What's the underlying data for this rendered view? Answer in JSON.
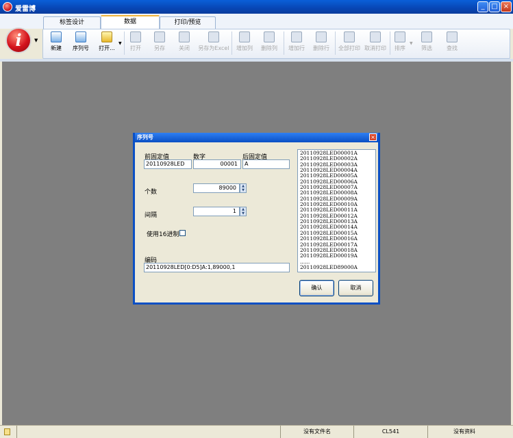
{
  "window": {
    "title": "爱雷博"
  },
  "ribbon": {
    "tabs": [
      {
        "label": "标签设计"
      },
      {
        "label": "数据"
      },
      {
        "label": "打印/预览"
      }
    ],
    "buttons": {
      "new": "新建",
      "serial": "序列号",
      "open_menu": "打开...",
      "open": "打开",
      "save_as": "另存",
      "close": "关闭",
      "save_excel": "另存为Excel",
      "add_column": "增加列",
      "delete_column": "删除列",
      "add_row": "增加行",
      "delete_row": "删除行",
      "print_all": "全部打印",
      "cancel_print": "取消打印",
      "sort": "排序",
      "filter": "筛选",
      "find": "查找"
    }
  },
  "dialog": {
    "title": "序列号",
    "prefix_label": "前固定值",
    "prefix_value": "20110928LED",
    "number_label": "数字",
    "number_value": "00001",
    "suffix_label": "后固定值",
    "suffix_value": "A",
    "count_label": "个数",
    "count_value": "89000",
    "interval_label": "间隔",
    "interval_value": "1",
    "hex_label": "使用16进制",
    "hex_checked": false,
    "code_label": "编码",
    "code_value": "20110928LED[0:D5]A:1,89000,1",
    "preview_items": [
      "20110928LED00001A",
      "20110928LED00002A",
      "20110928LED00003A",
      "20110928LED00004A",
      "20110928LED00005A",
      "20110928LED00006A",
      "20110928LED00007A",
      "20110928LED00008A",
      "20110928LED00009A",
      "20110928LED00010A",
      "20110928LED00011A",
      "20110928LED00012A",
      "20110928LED00013A",
      "20110928LED00014A",
      "20110928LED00015A",
      "20110928LED00016A",
      "20110928LED00017A",
      "20110928LED00018A",
      "20110928LED00019A",
      "......",
      "20110928LED89000A"
    ],
    "ok_label": "确认",
    "cancel_label": "取消"
  },
  "statusbar": {
    "file": "没有文件名",
    "printer": "CL541",
    "data": "没有资料"
  }
}
